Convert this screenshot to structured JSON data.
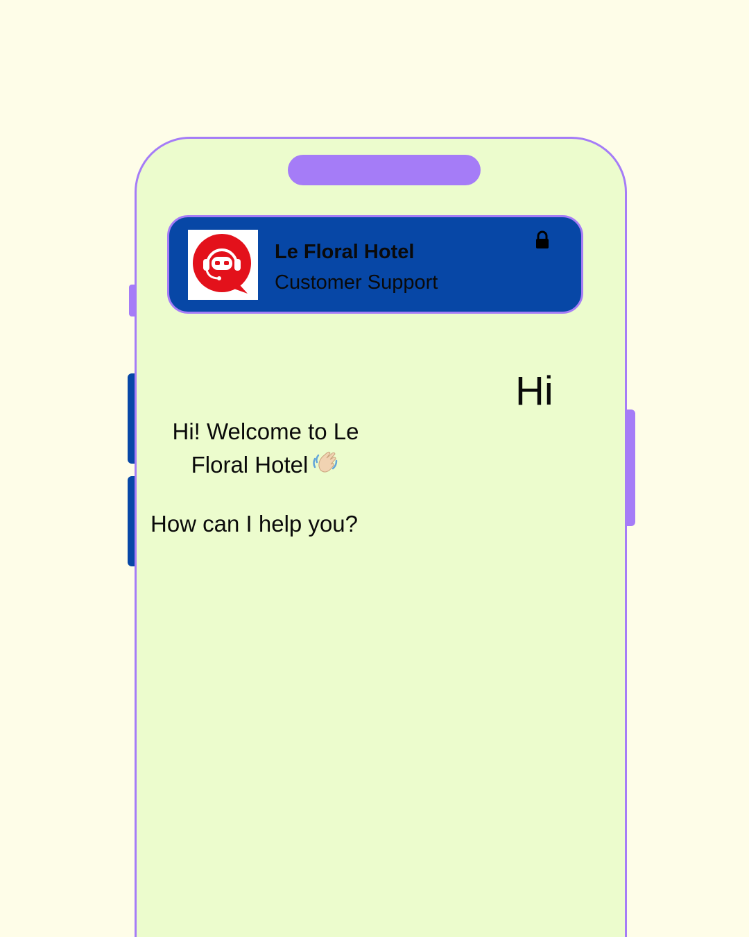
{
  "header": {
    "title": "Le Floral Hotel",
    "subtitle": "Customer Support",
    "avatar_icon": "support-bot-icon",
    "lock_icon": "lock-icon"
  },
  "chat": {
    "user_message": "Hi",
    "bot_greeting_line1": "Hi! Welcome to Le",
    "bot_greeting_line2": "Floral Hotel",
    "bot_greeting_emoji_icon": "waving-hand-icon",
    "bot_question": "How can I help you?"
  },
  "colors": {
    "page_background": "#fefde8",
    "phone_screen": "#ecfccd",
    "phone_accent": "#a57cf7",
    "header_background": "#0747a6",
    "avatar_red": "#e3111b"
  }
}
